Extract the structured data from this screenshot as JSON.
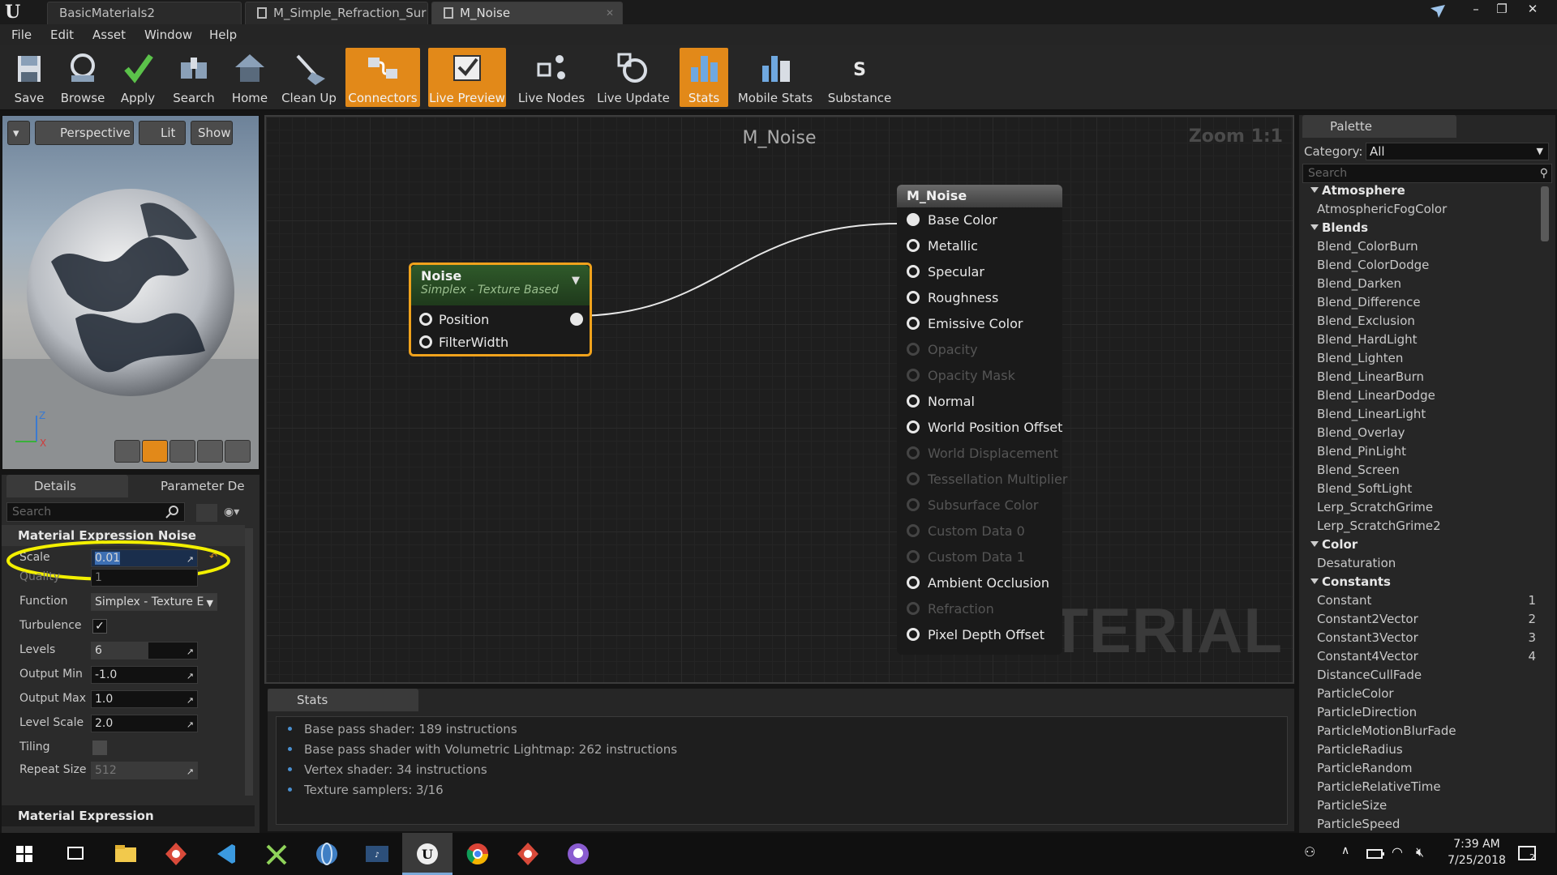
{
  "titlebar": {
    "tabs": [
      "BasicMaterials2",
      "M_Simple_Refraction_Sur",
      "M_Noise"
    ],
    "window_buttons": [
      "–",
      "❐",
      "✕"
    ]
  },
  "menu": [
    "File",
    "Edit",
    "Asset",
    "Window",
    "Help"
  ],
  "toolbar": {
    "buttons": [
      {
        "label": "Save",
        "icon": "save-icon"
      },
      {
        "label": "Browse",
        "icon": "browse-icon"
      },
      {
        "label": "Apply",
        "icon": "apply-icon"
      },
      {
        "label": "Search",
        "icon": "search-icon"
      },
      {
        "label": "Home",
        "icon": "home-icon"
      },
      {
        "label": "Clean Up",
        "icon": "cleanup-icon"
      },
      {
        "label": "Connectors",
        "icon": "connectors-icon",
        "active": true
      },
      {
        "label": "Live Preview",
        "icon": "live-preview-icon",
        "active": true
      },
      {
        "label": "Live Nodes",
        "icon": "live-nodes-icon"
      },
      {
        "label": "Live Update",
        "icon": "live-update-icon"
      },
      {
        "label": "Stats",
        "icon": "stats-icon",
        "active": true
      },
      {
        "label": "Mobile Stats",
        "icon": "mobile-stats-icon"
      },
      {
        "label": "Substance",
        "icon": "substance-icon"
      }
    ],
    "active_color": "#e28919"
  },
  "viewport": {
    "perspective": "Perspective",
    "lit": "Lit",
    "show": "Show",
    "axis_z": "Z",
    "axis_x": "X"
  },
  "details": {
    "tab_details": "Details",
    "tab_params": "Parameter De",
    "search_placeholder": "Search",
    "section": "Material Expression Noise",
    "properties": {
      "scale": {
        "label": "Scale",
        "value": "0.01"
      },
      "quality": {
        "label": "Quality",
        "value": "1"
      },
      "function": {
        "label": "Function",
        "value": "Simplex - Texture E"
      },
      "turbulence": {
        "label": "Turbulence",
        "checked": true
      },
      "levels": {
        "label": "Levels",
        "value": "6"
      },
      "output_min": {
        "label": "Output Min",
        "value": "-1.0"
      },
      "output_max": {
        "label": "Output Max",
        "value": "1.0"
      },
      "level_scale": {
        "label": "Level Scale",
        "value": "2.0"
      },
      "tiling": {
        "label": "Tiling",
        "checked": false
      },
      "repeat_size": {
        "label": "Repeat Size",
        "value": "512"
      }
    },
    "footer_section": "Material Expression",
    "highlight_color": "#f3f000"
  },
  "graph": {
    "title": "M_Noise",
    "zoom": "Zoom 1:1",
    "watermark": "MATERIAL",
    "noise_node": {
      "title": "Noise",
      "subtitle": "Simplex - Texture Based",
      "pins": [
        "Position",
        "FilterWidth"
      ]
    },
    "material_node": {
      "title": "M_Noise",
      "pins": [
        {
          "label": "Base Color",
          "enabled": true,
          "connected": true
        },
        {
          "label": "Metallic",
          "enabled": true
        },
        {
          "label": "Specular",
          "enabled": true
        },
        {
          "label": "Roughness",
          "enabled": true
        },
        {
          "label": "Emissive Color",
          "enabled": true
        },
        {
          "label": "Opacity",
          "enabled": false
        },
        {
          "label": "Opacity Mask",
          "enabled": false
        },
        {
          "label": "Normal",
          "enabled": true
        },
        {
          "label": "World Position Offset",
          "enabled": true
        },
        {
          "label": "World Displacement",
          "enabled": false
        },
        {
          "label": "Tessellation Multiplier",
          "enabled": false
        },
        {
          "label": "Subsurface Color",
          "enabled": false
        },
        {
          "label": "Custom Data 0",
          "enabled": false
        },
        {
          "label": "Custom Data 1",
          "enabled": false
        },
        {
          "label": "Ambient Occlusion",
          "enabled": true
        },
        {
          "label": "Refraction",
          "enabled": false
        },
        {
          "label": "Pixel Depth Offset",
          "enabled": true
        }
      ]
    }
  },
  "stats": {
    "tab": "Stats",
    "lines": [
      "Base pass shader: 189 instructions",
      "Base pass shader with Volumetric Lightmap: 262 instructions",
      "Vertex shader: 34 instructions",
      "Texture samplers: 3/16"
    ]
  },
  "palette": {
    "tab": "Palette",
    "category_label": "Category:",
    "category_value": "All",
    "search_placeholder": "Search",
    "entries": [
      {
        "type": "cat",
        "text": "Atmosphere"
      },
      {
        "type": "item",
        "text": "AtmosphericFogColor"
      },
      {
        "type": "cat",
        "text": "Blends"
      },
      {
        "type": "item",
        "text": "Blend_ColorBurn"
      },
      {
        "type": "item",
        "text": "Blend_ColorDodge"
      },
      {
        "type": "item",
        "text": "Blend_Darken"
      },
      {
        "type": "item",
        "text": "Blend_Difference"
      },
      {
        "type": "item",
        "text": "Blend_Exclusion"
      },
      {
        "type": "item",
        "text": "Blend_HardLight"
      },
      {
        "type": "item",
        "text": "Blend_Lighten"
      },
      {
        "type": "item",
        "text": "Blend_LinearBurn"
      },
      {
        "type": "item",
        "text": "Blend_LinearDodge"
      },
      {
        "type": "item",
        "text": "Blend_LinearLight"
      },
      {
        "type": "item",
        "text": "Blend_Overlay"
      },
      {
        "type": "item",
        "text": "Blend_PinLight"
      },
      {
        "type": "item",
        "text": "Blend_Screen"
      },
      {
        "type": "item",
        "text": "Blend_SoftLight"
      },
      {
        "type": "item",
        "text": "Lerp_ScratchGrime"
      },
      {
        "type": "item",
        "text": "Lerp_ScratchGrime2"
      },
      {
        "type": "cat",
        "text": "Color"
      },
      {
        "type": "item",
        "text": "Desaturation"
      },
      {
        "type": "cat",
        "text": "Constants"
      },
      {
        "type": "item",
        "text": "Constant",
        "hotkey": "1"
      },
      {
        "type": "item",
        "text": "Constant2Vector",
        "hotkey": "2"
      },
      {
        "type": "item",
        "text": "Constant3Vector",
        "hotkey": "3"
      },
      {
        "type": "item",
        "text": "Constant4Vector",
        "hotkey": "4"
      },
      {
        "type": "item",
        "text": "DistanceCullFade"
      },
      {
        "type": "item",
        "text": "ParticleColor"
      },
      {
        "type": "item",
        "text": "ParticleDirection"
      },
      {
        "type": "item",
        "text": "ParticleMotionBlurFade"
      },
      {
        "type": "item",
        "text": "ParticleRadius"
      },
      {
        "type": "item",
        "text": "ParticleRandom"
      },
      {
        "type": "item",
        "text": "ParticleRelativeTime"
      },
      {
        "type": "item",
        "text": "ParticleSize"
      },
      {
        "type": "item",
        "text": "ParticleSpeed"
      }
    ]
  },
  "taskbar": {
    "apps": [
      "windows-start-icon",
      "task-view-icon",
      "file-explorer-icon",
      "sourcetree-icon",
      "vscode-icon",
      "xnview-icon",
      "browser-globe-icon",
      "music-app-icon",
      "unreal-engine-icon",
      "chrome-icon",
      "sourcetree-icon-2",
      "github-desktop-icon"
    ],
    "time": "7:39 AM",
    "date": "7/25/2018",
    "notifications": "2"
  }
}
